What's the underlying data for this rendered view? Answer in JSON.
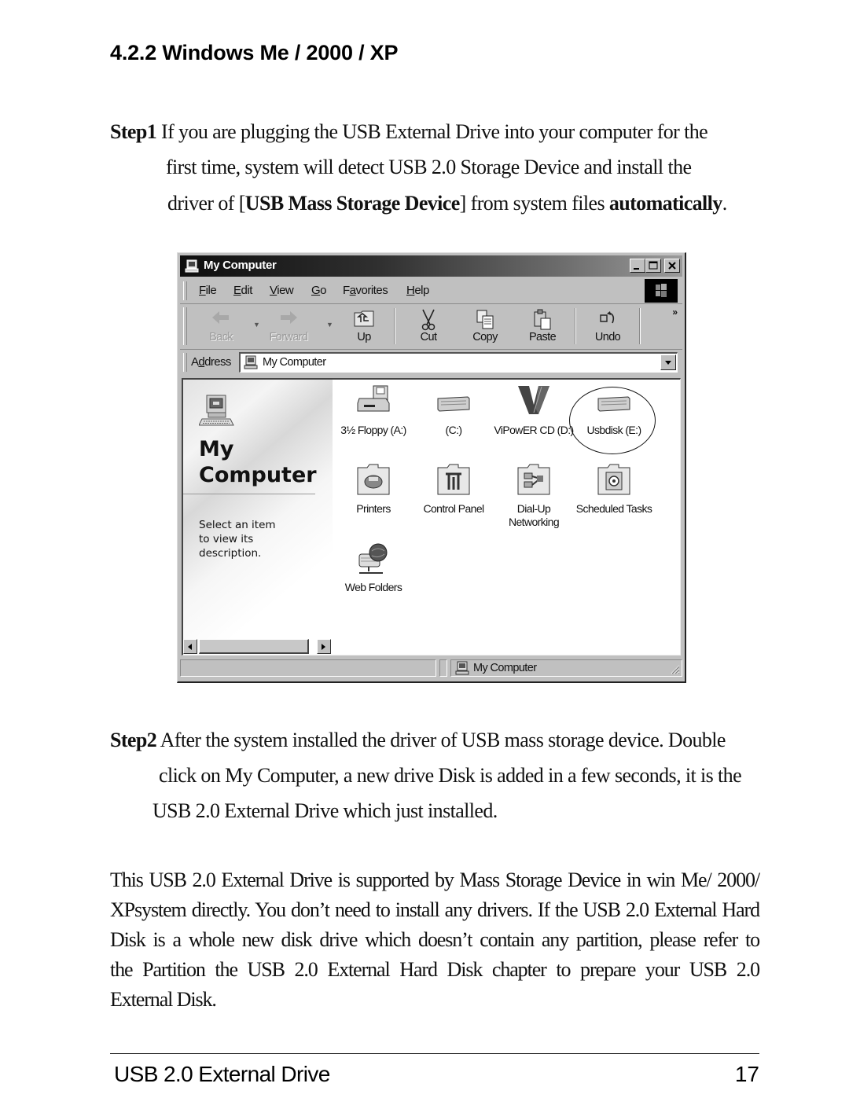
{
  "document": {
    "heading": "4.2.2 Windows Me / 2000 / XP",
    "step1": {
      "label": "Step1",
      "line1_rest": " If you are plugging the USB External Drive into your computer for the",
      "line2": "first time, system will detect USB 2.0 Storage Device and install the",
      "line3_pre": "driver of [",
      "line3_bold": "USB Mass Storage Device",
      "line3_mid": "] from system files ",
      "line3_bold2": "automatically",
      "line3_end": "."
    },
    "step2": {
      "label": "Step2",
      "line1_rest": " After the system installed the driver of USB mass storage device. Double",
      "line2": "click on My Computer, a new drive Disk is added in a few seconds, it is the",
      "line3": "USB 2.0 External Drive which just installed."
    },
    "body_lines": [
      "This USB 2.0 External Drive is supported by Mass Storage Device in win Me/ 2000/",
      "XPsystem directly. You don’t need to install any drivers. If the USB 2.0 External Hard",
      "Disk is a whole new disk drive which doesn’t contain any partition, please refer to",
      "the Partition the USB 2.0 External Hard Disk chapter to prepare your USB 2.0",
      "External Disk."
    ],
    "footer": {
      "title": "USB 2.0 External Drive",
      "page_number": "17"
    }
  },
  "window": {
    "title": "My Computer",
    "menu": [
      "File",
      "Edit",
      "View",
      "Go",
      "Favorites",
      "Help"
    ],
    "menu_accel": [
      "F",
      "E",
      "V",
      "G",
      "a",
      "H"
    ],
    "toolbar": {
      "back": "Back",
      "forward": "Forward",
      "up": "Up",
      "cut": "Cut",
      "copy": "Copy",
      "paste": "Paste",
      "undo": "Undo",
      "more": "»"
    },
    "address": {
      "label": "Address",
      "label_accel": "d",
      "value": "My Computer"
    },
    "left_pane": {
      "title_line1": "My",
      "title_line2": "Computer",
      "description": [
        "Select an item",
        "to view its",
        "description."
      ]
    },
    "items": [
      {
        "label": "3½ Floppy (A:)",
        "icon": "floppy-drive-icon"
      },
      {
        "label": "(C:)",
        "icon": "hard-drive-icon"
      },
      {
        "label": "ViPowER CD (D:)",
        "icon": "cd-drive-icon"
      },
      {
        "label": "Usbdisk (E:)",
        "icon": "usb-disk-icon",
        "highlighted": true
      },
      {
        "label": "Printers",
        "icon": "printers-folder-icon"
      },
      {
        "label": "Control Panel",
        "icon": "control-panel-folder-icon"
      },
      {
        "label": "Dial-Up Networking",
        "icon": "dialup-networking-folder-icon"
      },
      {
        "label": "Scheduled Tasks",
        "icon": "scheduled-tasks-folder-icon"
      },
      {
        "label": "Web Folders",
        "icon": "web-folders-icon"
      }
    ],
    "status": {
      "zone": "My Computer"
    }
  }
}
